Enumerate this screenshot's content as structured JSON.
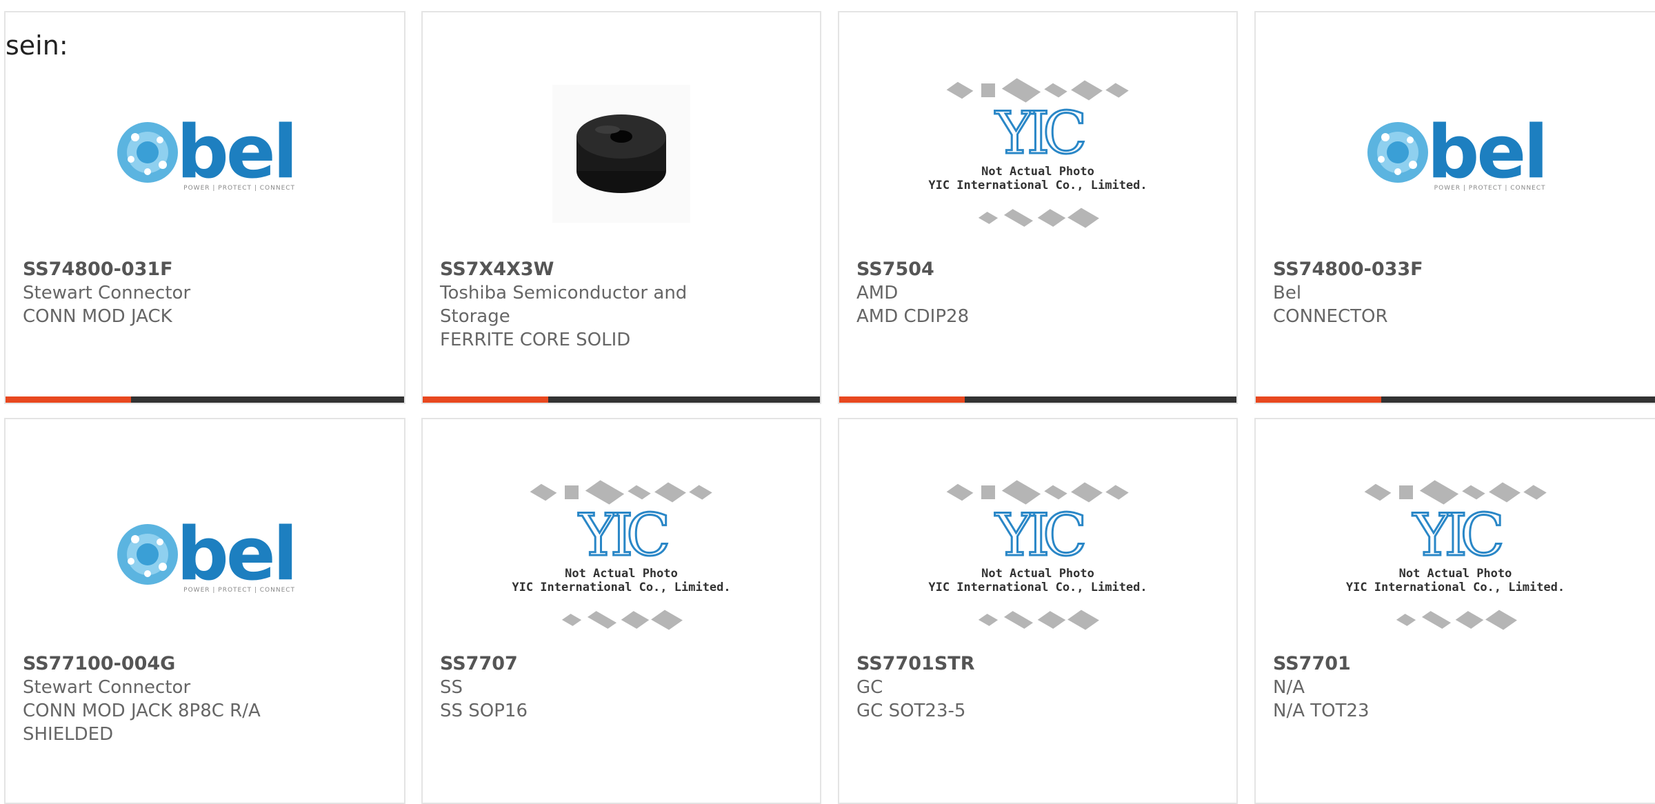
{
  "page_label": "sein:",
  "image_caption": {
    "line1": "Not Actual Photo",
    "line2": "YIC International Co., Limited."
  },
  "bel_logo": {
    "word": "bel",
    "tagline": "POWER | PROTECT | CONNECT"
  },
  "yic_logo": {
    "mark": "YIC"
  },
  "colors": {
    "accent": "#e8481f",
    "bar": "#333333",
    "bel_blue": "#1d7fc0",
    "yic_blue": "#2a87c7"
  },
  "products": [
    {
      "part_number": "SS74800-031F",
      "manufacturer": "Stewart Connector",
      "description": "CONN MOD JACK",
      "image": "bel-logo"
    },
    {
      "part_number": "SS7X4X3W",
      "manufacturer": "Toshiba Semiconductor and Storage",
      "description": "FERRITE CORE SOLID",
      "image": "ferrite-photo"
    },
    {
      "part_number": "SS7504",
      "manufacturer": "AMD",
      "description": "AMD CDIP28",
      "image": "yic-placeholder"
    },
    {
      "part_number": "SS74800-033F",
      "manufacturer": "Bel",
      "description": "CONNECTOR",
      "image": "bel-logo"
    },
    {
      "part_number": "SS77100-004G",
      "manufacturer": "Stewart Connector",
      "description": "CONN MOD JACK 8P8C R/A SHIELDED",
      "image": "bel-logo"
    },
    {
      "part_number": "SS7707",
      "manufacturer": "SS",
      "description": "SS SOP16",
      "image": "yic-placeholder"
    },
    {
      "part_number": "SS7701STR",
      "manufacturer": "GC",
      "description": "GC SOT23-5",
      "image": "yic-placeholder"
    },
    {
      "part_number": "SS7701",
      "manufacturer": "N/A",
      "description": "N/A TOT23",
      "image": "yic-placeholder"
    }
  ]
}
